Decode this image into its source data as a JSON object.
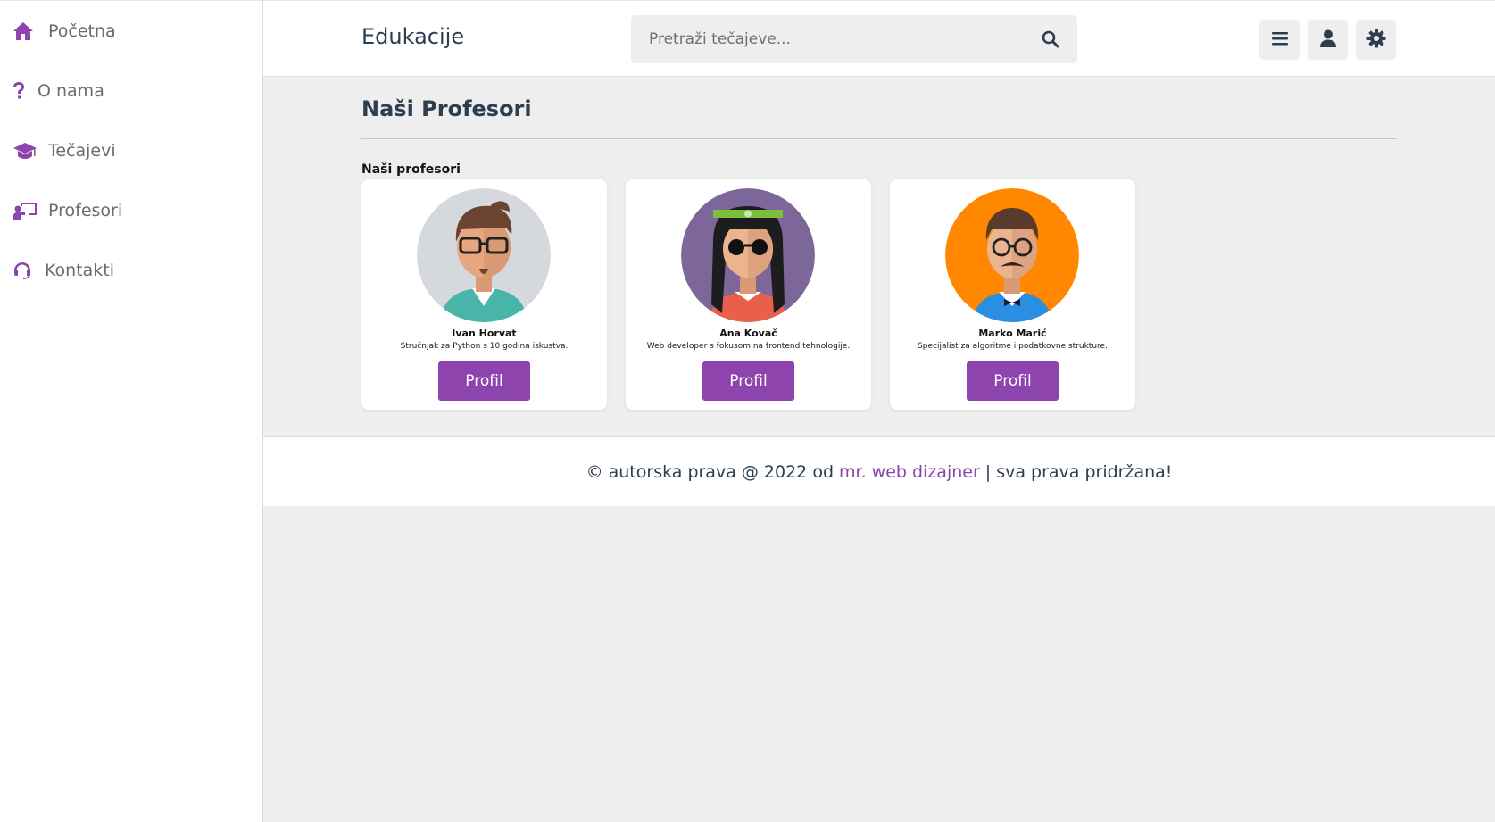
{
  "sidebar": {
    "items": [
      {
        "label": "Početna",
        "icon": "home-icon"
      },
      {
        "label": "O nama",
        "icon": "question-icon"
      },
      {
        "label": "Tečajevi",
        "icon": "graduation-cap-icon"
      },
      {
        "label": "Profesori",
        "icon": "chalkboard-teacher-icon"
      },
      {
        "label": "Kontakti",
        "icon": "headset-icon"
      }
    ]
  },
  "header": {
    "brand": "Edukacije",
    "search_placeholder": "Pretraži tečajeve...",
    "buttons": [
      "menu-icon",
      "user-icon",
      "gear-icon"
    ]
  },
  "main": {
    "title": "Naši Profesori",
    "subheading": "Naši profesori",
    "professors": [
      {
        "name": "Ivan Horvat",
        "description": "Stručnjak za Python s 10 godina iskustva.",
        "button": "Profil",
        "avatar_bg": "#d5d8dc"
      },
      {
        "name": "Ana Kovač",
        "description": "Web developer s fokusom na frontend tehnologije.",
        "button": "Profil",
        "avatar_bg": "#7d6699"
      },
      {
        "name": "Marko Marić",
        "description": "Specijalist za algoritme i podatkovne strukture.",
        "button": "Profil",
        "avatar_bg": "#ff8800"
      }
    ]
  },
  "footer": {
    "prefix": "© autorska prava @ 2022 od",
    "link": "mr. web dizajner",
    "suffix": "| sva prava pridržana!"
  },
  "colors": {
    "accent": "#8e44ad",
    "background": "#eeeeee",
    "text": "#2c3e50"
  }
}
